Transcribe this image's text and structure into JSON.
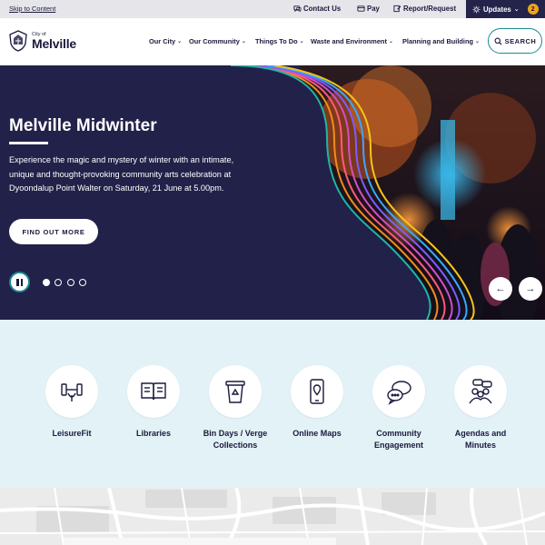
{
  "topbar": {
    "skip_link": "Skip to Content",
    "contact": "Contact Us",
    "pay": "Pay",
    "report": "Report/Request",
    "updates": "Updates",
    "updates_count": "2"
  },
  "header": {
    "logo_small": "City of",
    "logo_big": "Melville",
    "nav": [
      "Our City",
      "Our Community",
      "Things To Do",
      "Waste and Environment",
      "Planning and Building"
    ],
    "search_label": "SEARCH"
  },
  "hero": {
    "title": "Melville Midwinter",
    "text": "Experience the magic and mystery of winter with an intimate, unique and thought-provoking community arts celebration at Dyoondalup Point Walter on Saturday, 21 June at 5.00pm.",
    "cta": "FIND OUT MORE",
    "slide_count": 4,
    "active_slide": 1,
    "prev_arrow": "←",
    "next_arrow": "→"
  },
  "quick_links": [
    {
      "label": "LeisureFit",
      "icon": "dumbbell-icon"
    },
    {
      "label": "Libraries",
      "icon": "book-icon"
    },
    {
      "label": "Bin Days / Verge Collections",
      "icon": "recycle-bin-icon"
    },
    {
      "label": "Online Maps",
      "icon": "map-pin-phone-icon"
    },
    {
      "label": "Community Engagement",
      "icon": "chat-bubbles-icon"
    },
    {
      "label": "Agendas and Minutes",
      "icon": "meeting-icon"
    }
  ],
  "colors": {
    "navy": "#22214a",
    "teal": "#1a8a8e",
    "light_blue": "#e2f2f6",
    "badge": "#f0a51c"
  }
}
